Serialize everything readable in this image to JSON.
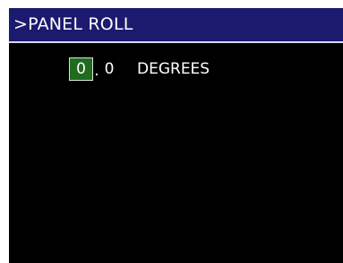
{
  "title_bar": {
    "prompt": ">",
    "title": "PANEL ROLL"
  },
  "value_editor": {
    "integer_digit": "0",
    "decimal_point": ".",
    "fraction_digit": "0",
    "units": "DEGREES"
  },
  "colors": {
    "title_background": "#1c1a6e",
    "screen_background": "#000000",
    "selected_digit_background": "#1f6b1f",
    "text": "#ffffff"
  }
}
